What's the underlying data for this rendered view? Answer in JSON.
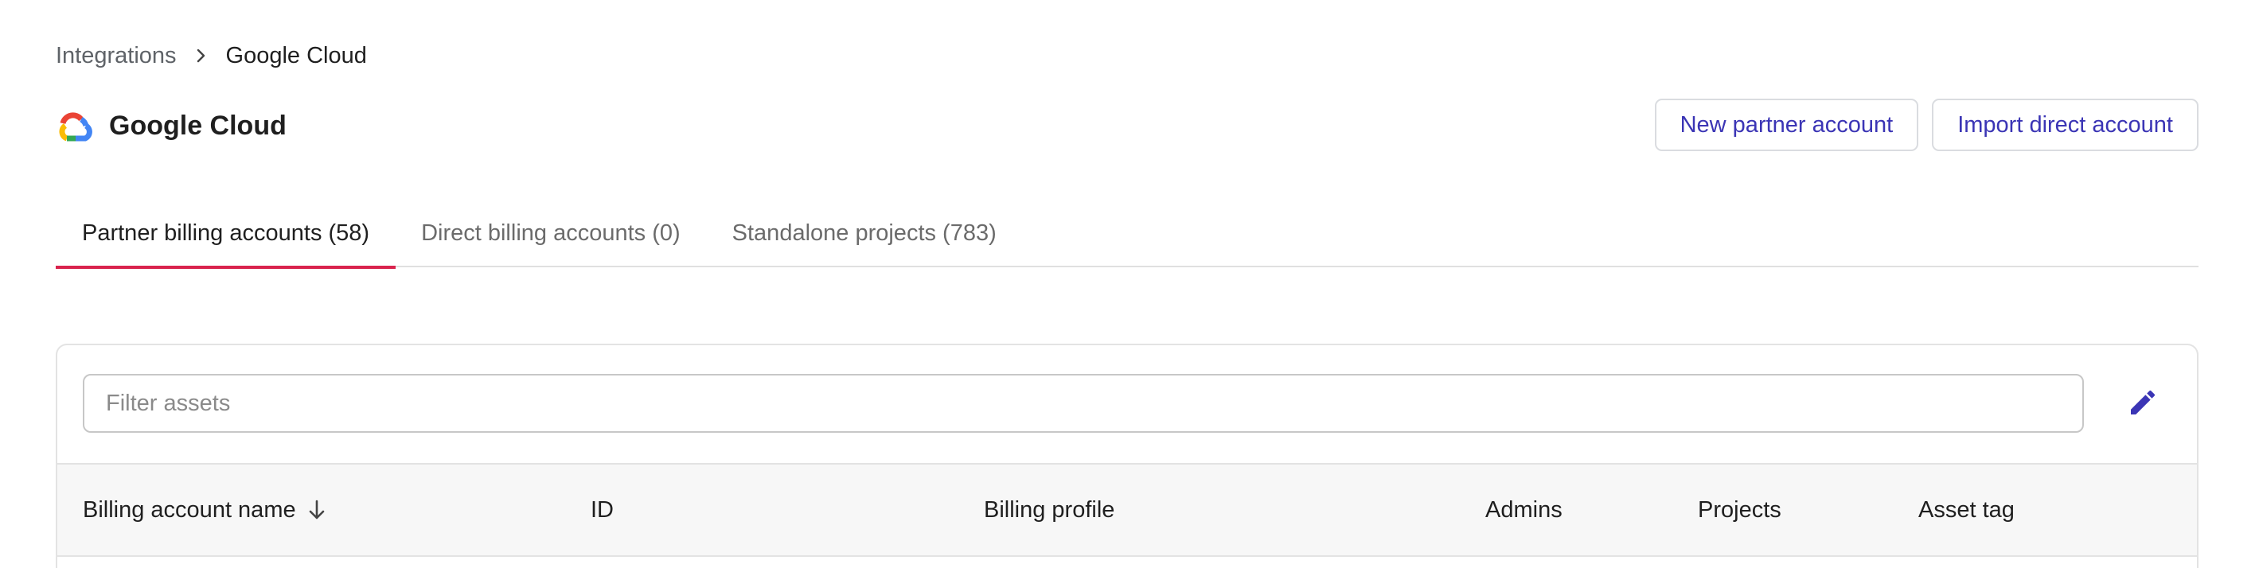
{
  "breadcrumb": {
    "parent": "Integrations",
    "current": "Google Cloud"
  },
  "header": {
    "title": "Google Cloud",
    "logo_icon": "google-cloud-logo",
    "actions": {
      "new_partner": "New partner account",
      "import_direct": "Import direct account"
    },
    "accent_color": "#3b35b5"
  },
  "tabs": [
    {
      "label": "Partner billing accounts (58)",
      "active": true
    },
    {
      "label": "Direct billing accounts (0)",
      "active": false
    },
    {
      "label": "Standalone projects (783)",
      "active": false
    }
  ],
  "tab_indicator_color": "#d9234d",
  "filter": {
    "placeholder": "Filter assets",
    "value": "",
    "edit_icon": "pencil-icon"
  },
  "table": {
    "columns": [
      {
        "label": "Billing account name",
        "sorted": "desc",
        "sort_icon": "arrow-down-icon"
      },
      {
        "label": "ID"
      },
      {
        "label": "Billing profile"
      },
      {
        "label": "Admins"
      },
      {
        "label": "Projects"
      },
      {
        "label": "Asset tag"
      }
    ]
  }
}
